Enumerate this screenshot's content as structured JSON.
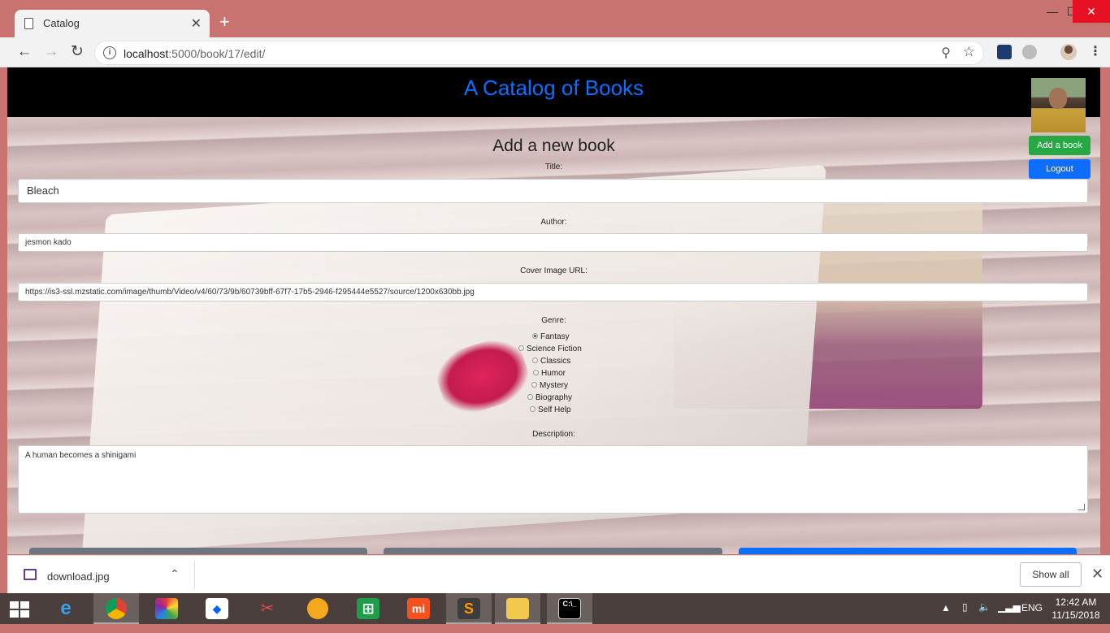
{
  "browser": {
    "tab_title": "Catalog",
    "url_host": "localhost",
    "url_path": ":5000/book/17/edit/"
  },
  "site": {
    "title": "A Catalog of Books",
    "add_book_label": "Add a book",
    "logout_label": "Logout"
  },
  "form": {
    "heading": "Add a new book",
    "title_label": "Title:",
    "title_value": "Bleach",
    "author_label": "Author:",
    "author_value": "jesmon kado",
    "cover_label": "Cover Image URL:",
    "cover_value": "https://is3-ssl.mzstatic.com/image/thumb/Video/v4/60/73/9b/60739bff-67f7-17b5-2946-f295444e5527/source/1200x630bb.jpg",
    "genre_label": "Genre:",
    "genres": [
      {
        "label": "Fantasy",
        "selected": true
      },
      {
        "label": "Science Fiction",
        "selected": false
      },
      {
        "label": "Classics",
        "selected": false
      },
      {
        "label": "Humor",
        "selected": false
      },
      {
        "label": "Mystery",
        "selected": false
      },
      {
        "label": "Biography",
        "selected": false
      },
      {
        "label": "Self Help",
        "selected": false
      }
    ],
    "description_label": "Description:",
    "description_value": "A human becomes a shinigami"
  },
  "download_shelf": {
    "file_name": "download.jpg",
    "show_all_label": "Show all"
  },
  "taskbar": {
    "language": "ENG",
    "time": "12:42 AM",
    "date": "11/15/2018"
  },
  "colors": {
    "title_bar": "#c97370",
    "site_title": "#0d6efd",
    "add_button": "#28a745",
    "logout_button": "#0d6efd"
  }
}
